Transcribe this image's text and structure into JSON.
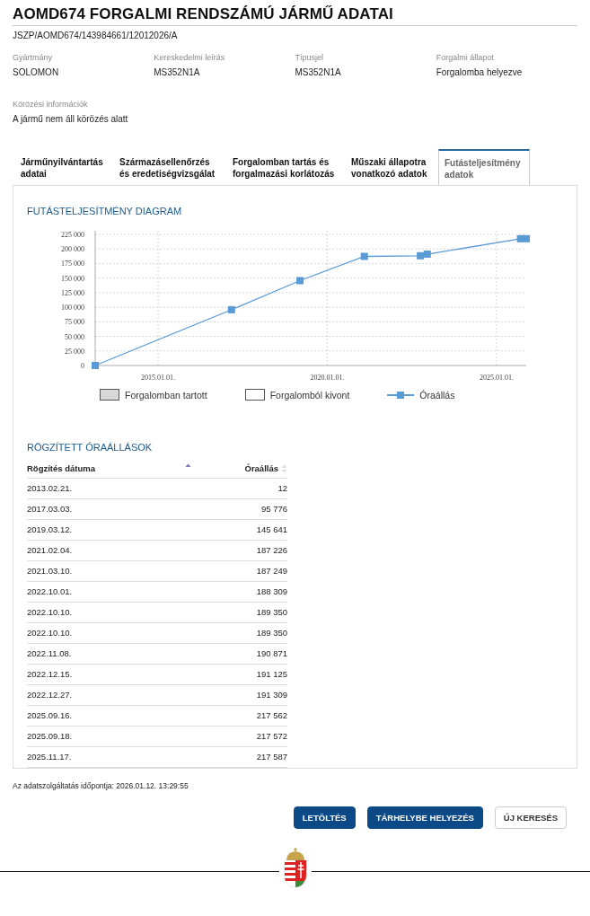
{
  "header": {
    "title": "AOMD674 FORGALMI RENDSZÁMÚ JÁRMŰ ADATAI",
    "reference": "JSZP/AOMD674/143984661/12012026/A"
  },
  "fields": [
    {
      "label": "Gyártmány",
      "value": "SOLOMON"
    },
    {
      "label": "Kereskedelmi leírás",
      "value": "MS352N1A"
    },
    {
      "label": "Típusjel",
      "value": "MS352N1A"
    },
    {
      "label": "Forgalmi állapot",
      "value": "Forgalomba helyezve"
    }
  ],
  "wanted_info": {
    "label": "Körözési információk",
    "value": "A jármű nem áll körözés alatt"
  },
  "tabs": [
    {
      "label": "Járműnyilvántartás adatai",
      "selected": false
    },
    {
      "label": "Származásellenőrzés és eredetiségvizsgálat",
      "selected": false
    },
    {
      "label": "Forgalomban tartás és forgalmazási korlátozás",
      "selected": false
    },
    {
      "label": "Műszaki állapotra vonatkozó adatok",
      "selected": false
    },
    {
      "label": "Futásteljesítmény adatok",
      "selected": true
    }
  ],
  "chart_section": {
    "title": "FUTÁSTELJESÍTMÉNY DIAGRAM",
    "chart_data": {
      "type": "line",
      "grid": true,
      "x": [
        "2013-02-21",
        "2017-03-03",
        "2019-03-12",
        "2021-02-04",
        "2021-03-10",
        "2022-10-01",
        "2022-10-10",
        "2022-10-10",
        "2022-11-08",
        "2022-12-15",
        "2022-12-27",
        "2025-09-16",
        "2025-09-18",
        "2025-11-17"
      ],
      "series": [
        {
          "name": "Óraállás",
          "color": "#5b9bd5",
          "values": [
            12,
            95776,
            145641,
            187226,
            187249,
            188309,
            189350,
            189350,
            190871,
            191125,
            191309,
            217562,
            217572,
            217587
          ]
        }
      ],
      "xlim": [
        "2013-02-21",
        "2025-11-17"
      ],
      "ylim": [
        0,
        225000
      ],
      "xticks": [
        {
          "value": "2015-01-01",
          "label": "2015.01.01."
        },
        {
          "value": "2020-01-01",
          "label": "2020.01.01."
        },
        {
          "value": "2025-01-01",
          "label": "2025.01.01."
        }
      ],
      "yticks": [
        {
          "value": 0,
          "label": "0"
        },
        {
          "value": 25000,
          "label": "25 000"
        },
        {
          "value": 50000,
          "label": "50 000"
        },
        {
          "value": 75000,
          "label": "75 000"
        },
        {
          "value": 100000,
          "label": "100 000"
        },
        {
          "value": 125000,
          "label": "125 000"
        },
        {
          "value": 150000,
          "label": "150 000"
        },
        {
          "value": 175000,
          "label": "175 000"
        },
        {
          "value": 200000,
          "label": "200 000"
        },
        {
          "value": 225000,
          "label": "225 000"
        }
      ]
    },
    "legend": [
      {
        "label": "Forgalomban tartott",
        "kind": "filled"
      },
      {
        "label": "Forgalomból kivont",
        "kind": "empty"
      },
      {
        "kind": "line"
      }
    ]
  },
  "table_section": {
    "title": "RÖGZÍTETT ÓRAÁLLÁSOK",
    "columns": [
      {
        "label": "Rögzítés dátuma",
        "sorted_ascending": true
      },
      {
        "label": "Óraállás",
        "sorted_ascending": false
      }
    ],
    "rows": [
      [
        "2013.02.21.",
        "12"
      ],
      [
        "2017.03.03.",
        "95 776"
      ],
      [
        "2019.03.12.",
        "145 641"
      ],
      [
        "2021.02.04.",
        "187 226"
      ],
      [
        "2021.03.10.",
        "187 249"
      ],
      [
        "2022.10.01.",
        "188 309"
      ],
      [
        "2022.10.10.",
        "189 350"
      ],
      [
        "2022.10.10.",
        "189 350"
      ],
      [
        "2022.11.08.",
        "190 871"
      ],
      [
        "2022.12.15.",
        "191 125"
      ],
      [
        "2022.12.27.",
        "191 309"
      ],
      [
        "2025.09.16.",
        "217 562"
      ],
      [
        "2025.09.18.",
        "217 572"
      ],
      [
        "2025.11.17.",
        "217 587"
      ]
    ]
  },
  "timestamp": "Az adatszolgáltatás időpontja: 2026.01.12. 13:29:55",
  "buttons": [
    {
      "label": "LETÖLTÉS",
      "kind": "primary"
    },
    {
      "label": "TÁRHELYBE HELYEZÉS",
      "kind": "primary"
    },
    {
      "label": "ÚJ KERESÉS",
      "kind": "secondary"
    }
  ]
}
